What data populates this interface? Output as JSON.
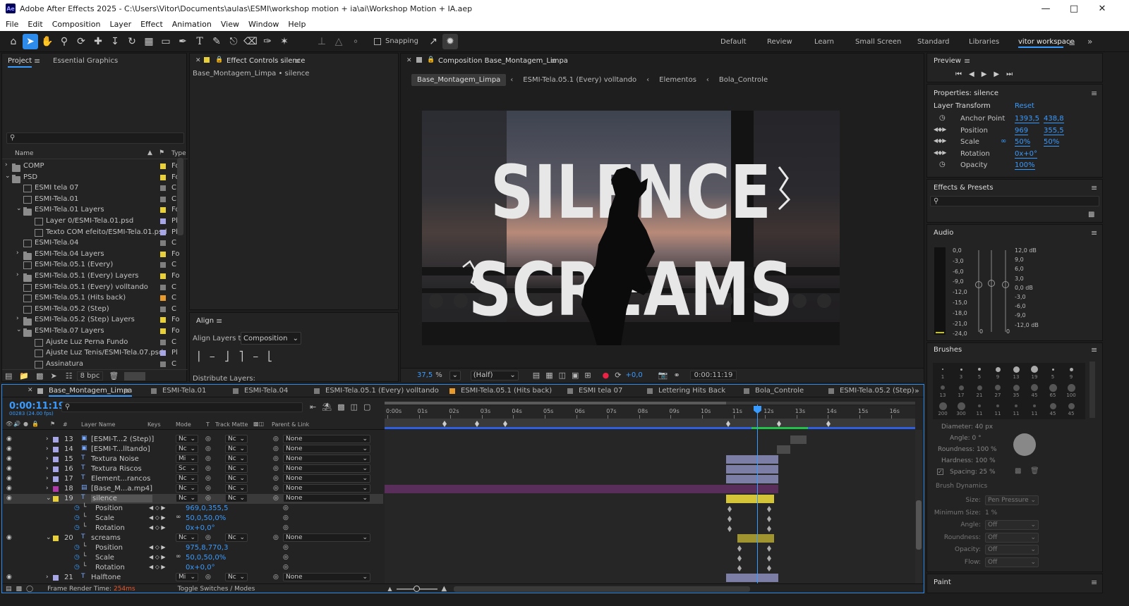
{
  "app": {
    "title": "Adobe After Effects 2025 - C:\\Users\\Vitor\\Documents\\aulas\\ESMI\\workshop motion + ia\\ai\\Workshop Motion + IA.aep",
    "logo": "Ae"
  },
  "menu": [
    "File",
    "Edit",
    "Composition",
    "Layer",
    "Effect",
    "Animation",
    "View",
    "Window",
    "Help"
  ],
  "toolbar": {
    "snapping": "Snapping"
  },
  "workspaces": [
    "Default",
    "Review",
    "Learn",
    "Small Screen",
    "Standard",
    "Libraries",
    "vitor workspace"
  ],
  "project": {
    "tab_project": "Project",
    "tab_eg": "Essential Graphics",
    "col_name": "Name",
    "col_type": "Type",
    "items": [
      {
        "name": "COMP",
        "type": "Fo",
        "indent": 0,
        "kind": "folder",
        "exp": "right",
        "color": "#e8d03a"
      },
      {
        "name": "PSD",
        "type": "Fo",
        "indent": 0,
        "kind": "folder",
        "exp": "down",
        "color": "#e8d03a"
      },
      {
        "name": "ESMI tela 07",
        "type": "C",
        "indent": 1,
        "kind": "comp",
        "exp": "",
        "color": "#7f7f7f"
      },
      {
        "name": "ESMI-Tela.01",
        "type": "C",
        "indent": 1,
        "kind": "comp",
        "exp": "",
        "color": "#7f7f7f"
      },
      {
        "name": "ESMI-Tela.01 Layers",
        "type": "Fo",
        "indent": 1,
        "kind": "folder",
        "exp": "down",
        "color": "#e8d03a"
      },
      {
        "name": "Layer 0/ESMI-Tela.01.psd",
        "type": "Pl",
        "indent": 2,
        "kind": "file",
        "exp": "",
        "color": "#a7a7e8"
      },
      {
        "name": "Texto COM efeito/ESMI-Tela.01.psd",
        "type": "Pl",
        "indent": 2,
        "kind": "file",
        "exp": "",
        "color": "#a7a7e8"
      },
      {
        "name": "ESMI-Tela.04",
        "type": "C",
        "indent": 1,
        "kind": "comp",
        "exp": "",
        "color": "#7f7f7f"
      },
      {
        "name": "ESMI-Tela.04 Layers",
        "type": "Fo",
        "indent": 1,
        "kind": "folder",
        "exp": "right",
        "color": "#e8d03a"
      },
      {
        "name": "ESMI-Tela.05.1 (Every)",
        "type": "C",
        "indent": 1,
        "kind": "comp",
        "exp": "",
        "color": "#7f7f7f"
      },
      {
        "name": "ESMI-Tela.05.1 (Every) Layers",
        "type": "Fo",
        "indent": 1,
        "kind": "folder",
        "exp": "right",
        "color": "#e8d03a"
      },
      {
        "name": "ESMI-Tela.05.1 (Every) volltando",
        "type": "C",
        "indent": 1,
        "kind": "comp",
        "exp": "",
        "color": "#7f7f7f"
      },
      {
        "name": "ESMI-Tela.05.1 (Hits back)",
        "type": "C",
        "indent": 1,
        "kind": "comp",
        "exp": "",
        "color": "#e89a2a"
      },
      {
        "name": "ESMI-Tela.05.2 (Step)",
        "type": "C",
        "indent": 1,
        "kind": "comp",
        "exp": "",
        "color": "#7f7f7f"
      },
      {
        "name": "ESMI-Tela.05.2 (Step) Layers",
        "type": "Fo",
        "indent": 1,
        "kind": "folder",
        "exp": "right",
        "color": "#e8d03a"
      },
      {
        "name": "ESMI-Tela.07 Layers",
        "type": "Fo",
        "indent": 1,
        "kind": "folder",
        "exp": "down",
        "color": "#e8d03a"
      },
      {
        "name": "Ajuste Luz Perna Fundo",
        "type": "C",
        "indent": 2,
        "kind": "comp",
        "exp": "",
        "color": "#7f7f7f"
      },
      {
        "name": "Ajuste Luz Tenis/ESMI-Tela.07.psd",
        "type": "Pl",
        "indent": 2,
        "kind": "file",
        "exp": "",
        "color": "#a7a7e8"
      },
      {
        "name": "Assinatura",
        "type": "C",
        "indent": 2,
        "kind": "comp",
        "exp": "",
        "color": "#7f7f7f"
      }
    ],
    "bpc": "8 bpc"
  },
  "effect_controls": {
    "tab": "Effect Controls silence",
    "subtitle": "Base_Montagem_Limpa • silence"
  },
  "align": {
    "title": "Align",
    "align_to_label": "Align Layers to:",
    "align_to_value": "Composition",
    "distribute": "Distribute Layers:"
  },
  "composition": {
    "tab": "Composition Base_Montagem_Limpa",
    "breadcrumbs": [
      "Base_Montagem_Limpa",
      "ESMI-Tela.05.1 (Every) volltando",
      "Elementos",
      "Bola_Controle"
    ],
    "viewer": {
      "line1": "SILENCE",
      "line2": "SCREAMS"
    },
    "footer": {
      "zoom": "37,5",
      "zoom_unit": "%",
      "resolution": "(Half)",
      "exposure": "+0,0",
      "timecode": "0:00:11:19"
    }
  },
  "preview": {
    "title": "Preview"
  },
  "properties": {
    "title": "Properties: silence",
    "section": "Layer Transform",
    "reset": "Reset",
    "rows": [
      {
        "label": "Anchor Point",
        "v1": "1393,5",
        "v2": "438,8"
      },
      {
        "label": "Position",
        "v1": "969",
        "v2": "355,5"
      },
      {
        "label": "Scale",
        "v1": "50%",
        "v2": "50%"
      },
      {
        "label": "Rotation",
        "v1": "0x+0°",
        "v2": ""
      },
      {
        "label": "Opacity",
        "v1": "100%",
        "v2": ""
      }
    ]
  },
  "effects_presets": {
    "title": "Effects & Presets"
  },
  "audio": {
    "title": "Audio",
    "left": [
      "0,0",
      "-3,0",
      "-6,0",
      "-9,0",
      "-12,0",
      "-15,0",
      "-18,0",
      "-21,0",
      "-24,0"
    ],
    "right": [
      "12,0 dB",
      "9,0",
      "6,0",
      "3,0",
      "0,0 dB",
      "-3,0",
      "-6,0",
      "-9,0",
      "-12,0 dB"
    ],
    "zero_left": "0",
    "zero_right": "0"
  },
  "brushes": {
    "title": "Brushes",
    "sizes": [
      "1",
      "3",
      "5",
      "9",
      "13",
      "19",
      "5",
      "9",
      "13",
      "17",
      "21",
      "27",
      "35",
      "45",
      "65",
      "100",
      "200",
      "300",
      "11",
      "11",
      "11",
      "11",
      "45",
      "45"
    ],
    "diameter": "Diameter: 40 px",
    "angle": "Angle: 0 °",
    "roundness": "Roundness: 100 %",
    "hardness": "Hardness: 100 %",
    "spacing": "Spacing: 25 %",
    "dynamics": "Brush Dynamics",
    "dyn_rows": [
      {
        "label": "Size:",
        "value": "Pen Pressure"
      },
      {
        "label": "Minimum Size:",
        "value": "1 %"
      },
      {
        "label": "Angle:",
        "value": "Off"
      },
      {
        "label": "Roundness:",
        "value": "Off"
      },
      {
        "label": "Opacity:",
        "value": "Off"
      },
      {
        "label": "Flow:",
        "value": "Off"
      }
    ]
  },
  "paint": {
    "title": "Paint"
  },
  "timeline": {
    "tabs": [
      "Base_Montagem_Limpa",
      "ESMI-Tela.01",
      "ESMI-Tela.04",
      "ESMI-Tela.05.1 (Every) volltando",
      "ESMI-Tela.05.1 (Hits back)",
      "ESMI tela 07",
      "Lettering Hits Back",
      "Bola_Controle",
      "ESMI-Tela.05.2 (Step)"
    ],
    "timecode": "0:00:11:19",
    "frames": "00283 (24.00 fps)",
    "cols": {
      "layer_name": "Layer Name",
      "keys": "Keys",
      "mode": "Mode",
      "t": "T",
      "track_matte": "Track Matte",
      "parent": "Parent & Link"
    },
    "ruler": [
      "0:00s",
      "01s",
      "02s",
      "03s",
      "04s",
      "05s",
      "06s",
      "07s",
      "08s",
      "09s",
      "10s",
      "11s",
      "12s",
      "13s",
      "14s",
      "15s",
      "16s"
    ],
    "layers": [
      {
        "num": "13",
        "name": "[ESMI-T...2 (Step)]",
        "mode": "Nc",
        "matte": "Nc",
        "parent": "None",
        "color": "#a7a7e8",
        "icon": "comp",
        "kind": "layer"
      },
      {
        "num": "14",
        "name": "[ESMI-T...lltando]",
        "mode": "Nc",
        "matte": "Nc",
        "parent": "None",
        "color": "#a7a7e8",
        "icon": "comp",
        "kind": "layer"
      },
      {
        "num": "15",
        "name": "Textura Noise",
        "mode": "Mi",
        "matte": "Nc",
        "parent": "None",
        "color": "#a7a7e8",
        "icon": "text",
        "kind": "layer"
      },
      {
        "num": "16",
        "name": "Textura Riscos",
        "mode": "Sc",
        "matte": "Nc",
        "parent": "None",
        "color": "#a7a7e8",
        "icon": "text",
        "kind": "layer"
      },
      {
        "num": "17",
        "name": "Element...rancos",
        "mode": "Nc",
        "matte": "Nc",
        "parent": "None",
        "color": "#a7a7e8",
        "icon": "text",
        "kind": "layer"
      },
      {
        "num": "18",
        "name": "[Base_M...a.mp4]",
        "mode": "Nc",
        "matte": "Nc",
        "parent": "None",
        "color": "#b03aa8",
        "icon": "file",
        "kind": "layer"
      },
      {
        "num": "19",
        "name": "silence",
        "mode": "Nc",
        "matte": "Nc",
        "parent": "None",
        "color": "#e8d03a",
        "icon": "text",
        "kind": "layer",
        "selected": true
      },
      {
        "name": "Position",
        "value": "969,0,355,5",
        "kind": "prop"
      },
      {
        "name": "Scale",
        "value": "50,0,50,0%",
        "kind": "prop"
      },
      {
        "name": "Rotation",
        "value": "0x+0,0°",
        "kind": "prop"
      },
      {
        "num": "20",
        "name": "screams",
        "mode": "Nc",
        "matte": "Nc",
        "parent": "None",
        "color": "#e8d03a",
        "icon": "text",
        "kind": "layer"
      },
      {
        "name": "Position",
        "value": "975,8,770,3",
        "kind": "prop"
      },
      {
        "name": "Scale",
        "value": "50,0,50,0%",
        "kind": "prop"
      },
      {
        "name": "Rotation",
        "value": "0x+0,0°",
        "kind": "prop"
      },
      {
        "num": "21",
        "name": "Halftone",
        "mode": "Mi",
        "matte": "Nc",
        "parent": "None",
        "color": "#a7a7e8",
        "icon": "text",
        "kind": "layer"
      }
    ],
    "footer": {
      "render_label": "Frame Render Time:",
      "render_value": "254ms",
      "toggle": "Toggle Switches / Modes"
    }
  }
}
